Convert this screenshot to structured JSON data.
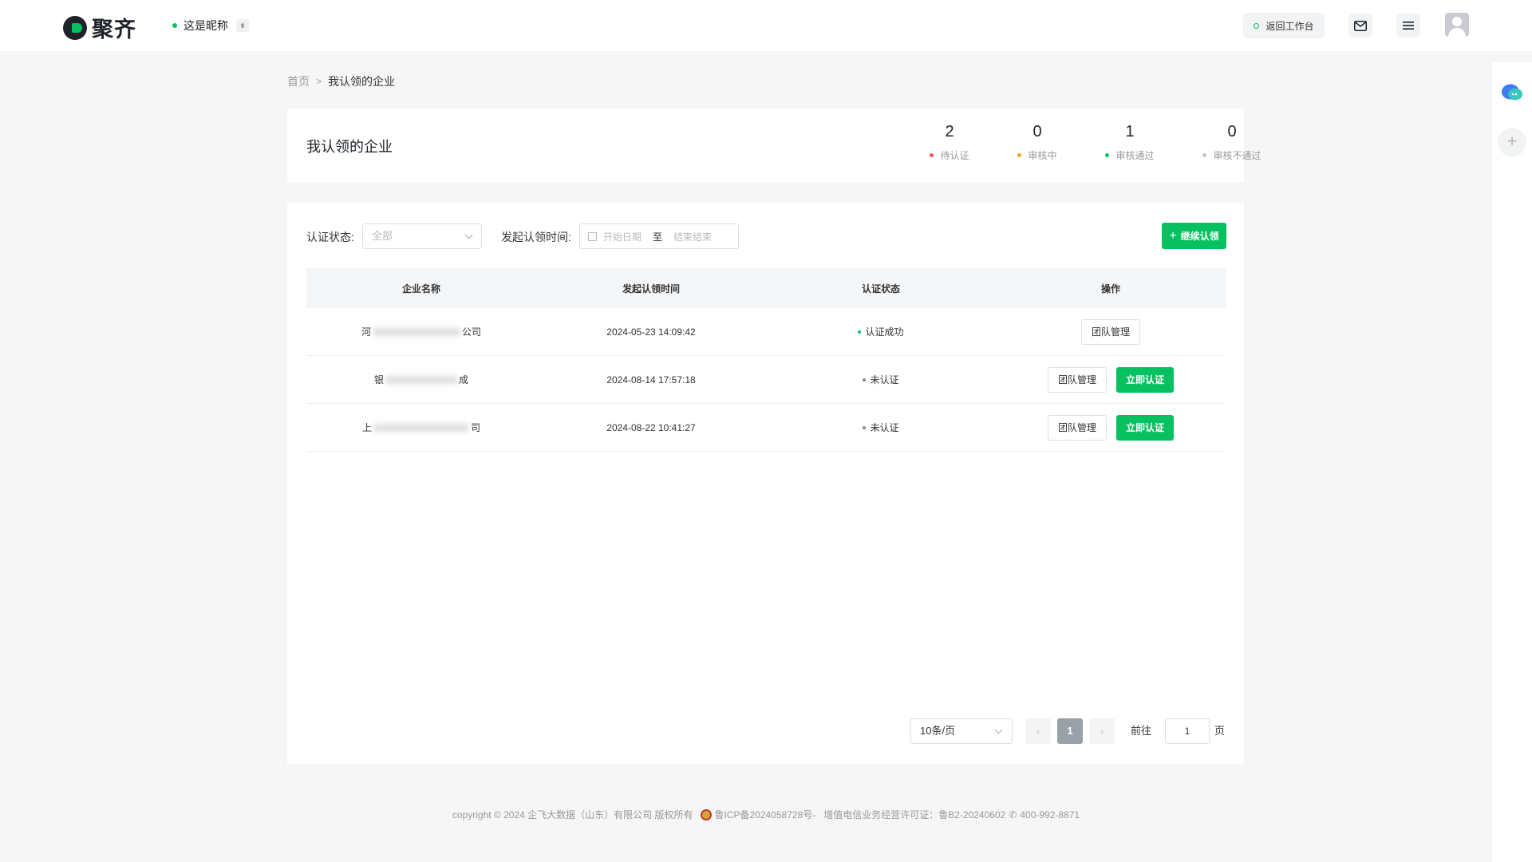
{
  "header": {
    "logo_text": "聚齐",
    "nickname": "这是昵称",
    "back_label": "返回工作台",
    "caret": "⇟"
  },
  "breadcrumb": {
    "home": "首页",
    "separator": ">",
    "current": "我认领的企业"
  },
  "stats": {
    "title": "我认领的企业",
    "items": [
      {
        "value": "2",
        "label": "待认证",
        "color": "#f5584a"
      },
      {
        "value": "0",
        "label": "审核中",
        "color": "#f5a623"
      },
      {
        "value": "1",
        "label": "审核通过",
        "color": "#07c160"
      },
      {
        "value": "0",
        "label": "审核不通过",
        "color": "#c0c4cc"
      }
    ]
  },
  "filters": {
    "status_label": "认证状态:",
    "status_value": "全部",
    "time_label": "发起认领时间:",
    "start_placeholder": "开始日期",
    "to": "至",
    "end_placeholder": "结束结束",
    "add_button": "继续认领"
  },
  "table": {
    "headers": [
      "企业名称",
      "发起认领时间",
      "认证状态",
      "操作"
    ],
    "rows": [
      {
        "name_start": "河",
        "name_end": "公司",
        "time": "2024-05-23 14:09:42",
        "status": "认证成功",
        "status_color": "#07c160",
        "manage": "团队管理",
        "certify": ""
      },
      {
        "name_start": "银",
        "name_end": "成",
        "time": "2024-08-14 17:57:18",
        "status": "未认证",
        "status_color": "#888888",
        "manage": "团队管理",
        "certify": "立即认证"
      },
      {
        "name_start": "上",
        "name_end": "司",
        "time": "2024-08-22 10:41:27",
        "status": "未认证",
        "status_color": "#888888",
        "manage": "团队管理",
        "certify": "立即认证"
      }
    ]
  },
  "pagination": {
    "page_size": "10条/页",
    "prev": "‹",
    "current": "1",
    "next": "›",
    "goto_label": "前往",
    "goto_value": "1",
    "page_suffix": "页"
  },
  "footer": {
    "copyright": "copyright © 2024 企飞大数据（山东）有限公司 版权所有",
    "icp": "鲁ICP备2024058728号-",
    "license": "增值电信业务经营许可证：鲁B2-20240602",
    "phone": "400-992-8871"
  },
  "colors": {
    "brand": "#07c160"
  }
}
